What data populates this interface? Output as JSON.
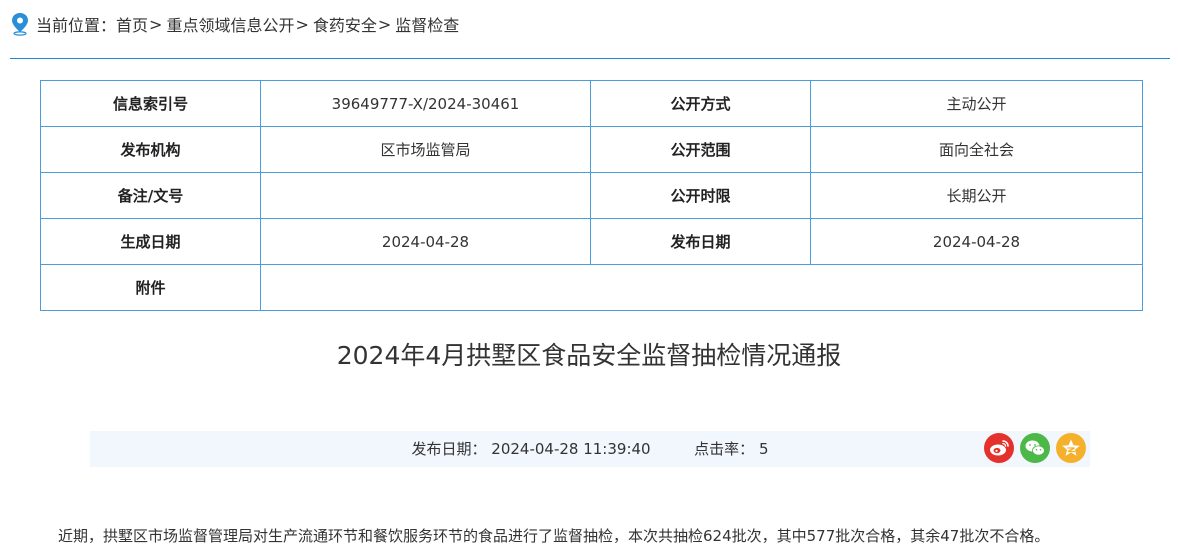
{
  "breadcrumb": {
    "prefix": "当前位置：",
    "items": [
      "首页",
      "重点领域信息公开",
      "食药安全",
      "监督检查"
    ],
    "separator": ">"
  },
  "meta_table": {
    "rows": [
      {
        "label1": "信息索引号",
        "value1": "39649777-X/2024-30461",
        "label2": "公开方式",
        "value2": "主动公开"
      },
      {
        "label1": "发布机构",
        "value1": "区市场监管局",
        "label2": "公开范围",
        "value2": "面向全社会"
      },
      {
        "label1": "备注/文号",
        "value1": "",
        "label2": "公开时限",
        "value2": "长期公开"
      },
      {
        "label1": "生成日期",
        "value1": "2024-04-28",
        "label2": "发布日期",
        "value2": "2024-04-28"
      }
    ],
    "attachment_label": "附件",
    "attachment_value": ""
  },
  "article": {
    "title": "2024年4月拱墅区食品安全监督抽检情况通报",
    "publish_label": "发布日期：",
    "publish_value": "2024-04-28 11:39:40",
    "clicks_label": "点击率：",
    "clicks_value": "5",
    "body_first_line": "近期，拱墅区市场监督管理局对生产流通环节和餐饮服务环节的食品进行了监督抽检，本次共抽检624批次，其中577批次合格，其余47批次不合格。"
  },
  "share": {
    "icons": [
      "weibo-icon",
      "wechat-icon",
      "qzone-icon"
    ],
    "colors": {
      "weibo": "#e4312b",
      "wechat": "#4cb848",
      "qzone": "#f6b12c"
    }
  },
  "colors": {
    "accent": "#1f8ad1",
    "table_border": "#4a9ddb",
    "info_bar_bg": "#f1f7fd"
  }
}
